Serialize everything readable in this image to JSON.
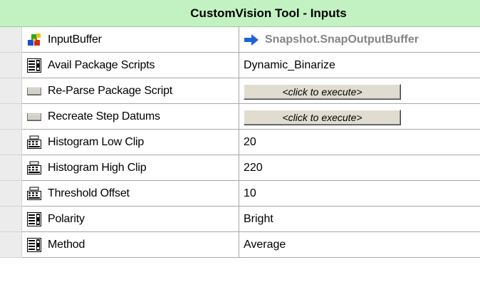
{
  "header": {
    "title": "CustomVision Tool - Inputs"
  },
  "rows": [
    {
      "name": "InputBuffer",
      "icon": "puzzle-icon",
      "value": "Snapshot.SnapOutputBuffer",
      "value_icon": "arrow-right-icon",
      "kind": "ref"
    },
    {
      "name": "Avail Package Scripts",
      "icon": "list-icon",
      "value": "Dynamic_Binarize",
      "kind": "list"
    },
    {
      "name": "Re-Parse Package Script",
      "icon": "button-icon",
      "value": "<click to execute>",
      "kind": "button"
    },
    {
      "name": "Recreate Step Datums",
      "icon": "button-icon",
      "value": "<click to execute>",
      "kind": "button"
    },
    {
      "name": "Histogram Low Clip",
      "icon": "keyboard-icon",
      "value": "20",
      "kind": "number"
    },
    {
      "name": "Histogram High Clip",
      "icon": "keyboard-icon",
      "value": "220",
      "kind": "number"
    },
    {
      "name": "Threshold Offset",
      "icon": "keyboard-icon",
      "value": "10",
      "kind": "number"
    },
    {
      "name": "Polarity",
      "icon": "list-icon",
      "value": "Bright",
      "kind": "list"
    },
    {
      "name": "Method",
      "icon": "list-icon",
      "value": "Average",
      "kind": "list"
    }
  ],
  "colors": {
    "header_bg": "#c2f2c2",
    "arrow": "#1e64d8",
    "ref_text": "#858585"
  }
}
